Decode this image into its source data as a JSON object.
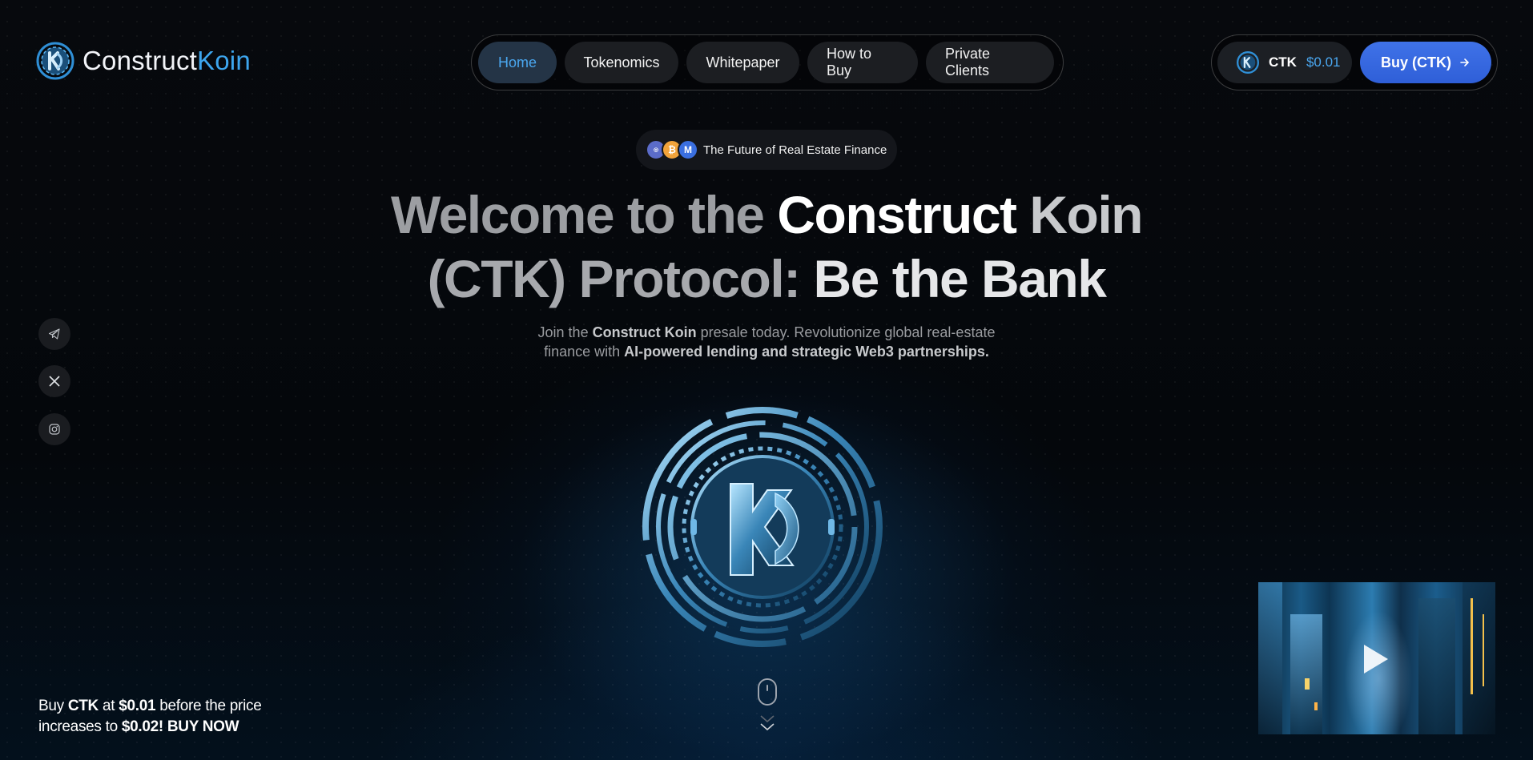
{
  "brand": {
    "name_part1": "Construct",
    "name_part2": "Koin"
  },
  "nav": {
    "items": [
      {
        "label": "Home",
        "active": true
      },
      {
        "label": "Tokenomics"
      },
      {
        "label": "Whitepaper"
      },
      {
        "label": "How to Buy"
      },
      {
        "label": "Private Clients"
      }
    ]
  },
  "ticker": {
    "symbol": "CTK",
    "price": "$0.01"
  },
  "buy_button": {
    "label": "Buy (CTK)"
  },
  "badge": {
    "text": "The Future of Real Estate Finance",
    "icons": [
      "coin-partner-icon",
      "bitcoin-icon",
      "coinmarketcap-icon"
    ]
  },
  "headline": {
    "line1_a": "Welcome to the ",
    "line1_b": "Construct ",
    "line1_c": "Koin",
    "line2_a": "(CTK) Protocol: ",
    "line2_b": "Be the Bank"
  },
  "subtitle": {
    "p1": "Join the ",
    "p2": "Construct Koin",
    "p3": " presale today. Revolutionize global real-estate",
    "p4": "finance with ",
    "p5": "AI-powered lending and strategic Web3 partnerships."
  },
  "social": [
    "telegram-icon",
    "x-icon",
    "instagram-icon"
  ],
  "promo": {
    "t1": "Buy ",
    "t2": "CTK",
    "t3": " at ",
    "t4": "$0.01",
    "t5": " before the price",
    "t6": "increases to ",
    "t7": "$0.02! BUY NOW"
  },
  "colors": {
    "accent": "#4aa7f0",
    "button": "#3f72e8",
    "background": "#05070a"
  }
}
